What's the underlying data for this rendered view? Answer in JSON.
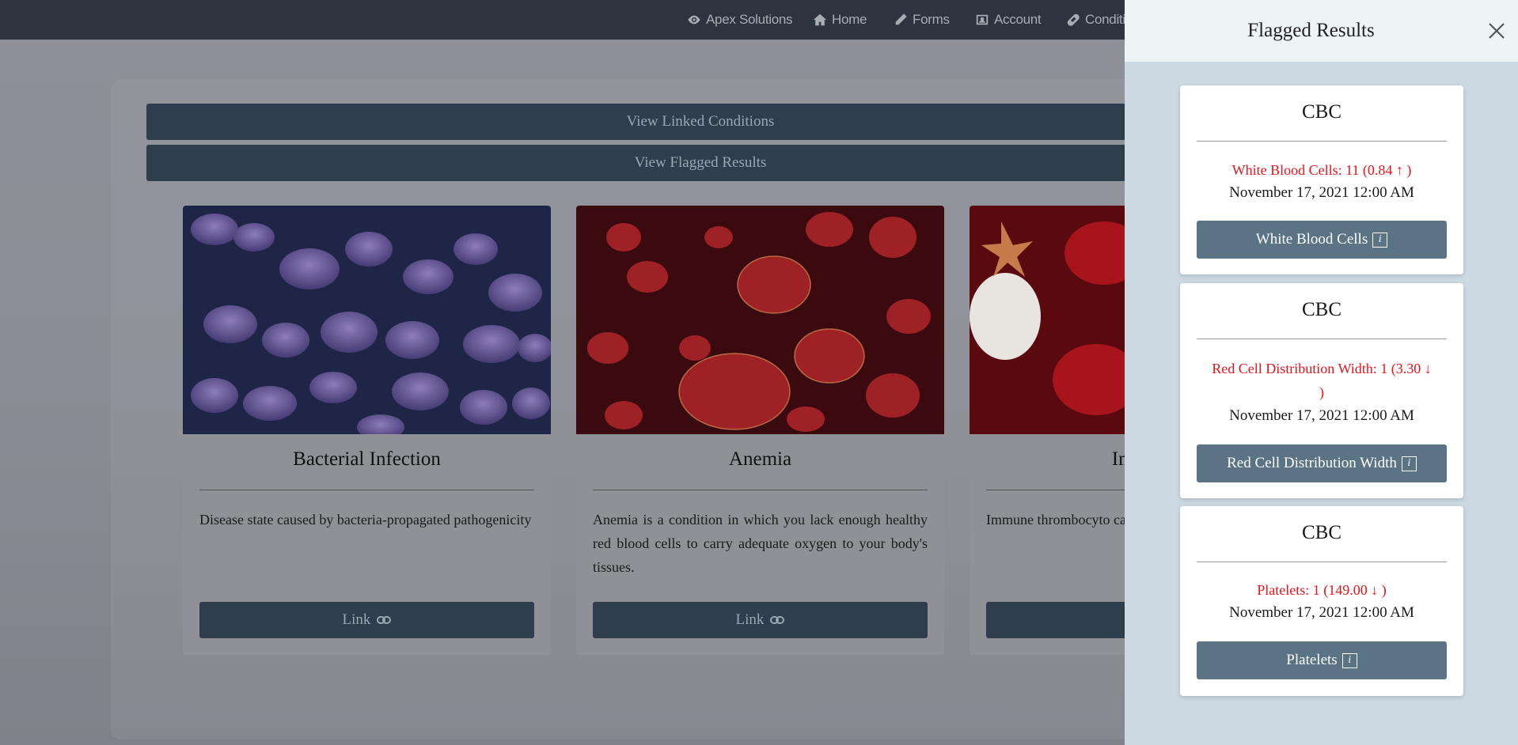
{
  "navbar": {
    "items": [
      {
        "label": "Apex Solutions",
        "icon": "eye-icon"
      },
      {
        "label": "Home",
        "icon": "home-icon"
      },
      {
        "label": "Forms",
        "icon": "pencil-icon"
      },
      {
        "label": "Account",
        "icon": "user-badge-icon"
      },
      {
        "label": "Conditi",
        "icon": "pill-icon"
      }
    ]
  },
  "main": {
    "view_linked_conditions": "View Linked Conditions",
    "view_flagged_results": "View Flagged Results",
    "cards": [
      {
        "title": "Bacterial Infection",
        "description": "Disease state caused by bacteria-propagated pathogenicity",
        "link_label": "Link"
      },
      {
        "title": "Anemia",
        "description": "Anemia is a condition in which you lack enough healthy red blood cells to carry adequate oxygen to your body's tissues.",
        "link_label": "Link"
      },
      {
        "title": "Immune T",
        "description": "Immune thrombocyto can lead to easy or exc",
        "link_label": ""
      }
    ]
  },
  "flyout": {
    "title": "Flagged Results",
    "results": [
      {
        "panel": "CBC",
        "value_line_1": "White Blood Cells: 11 (0.84 ↑ )",
        "value_line_2": "",
        "date": "November 17, 2021 12:00 AM",
        "button_label": "White Blood Cells"
      },
      {
        "panel": "CBC",
        "value_line_1": "Red Cell Distribution Width: 1 (3.30 ↓",
        "value_line_2": ")",
        "date": "November 17, 2021 12:00 AM",
        "button_label": "Red Cell Distribution Width"
      },
      {
        "panel": "CBC",
        "value_line_1": "Platelets: 1 (149.00 ↓ )",
        "value_line_2": "",
        "date": "November 17, 2021 12:00 AM",
        "button_label": "Platelets"
      }
    ]
  },
  "colors": {
    "navbar_bg": "#2c3440",
    "button_dark": "#2f3e4d",
    "flyout_bg": "#ccd9e2",
    "flagged_red": "#e8141b",
    "info_button": "#5a7385"
  }
}
